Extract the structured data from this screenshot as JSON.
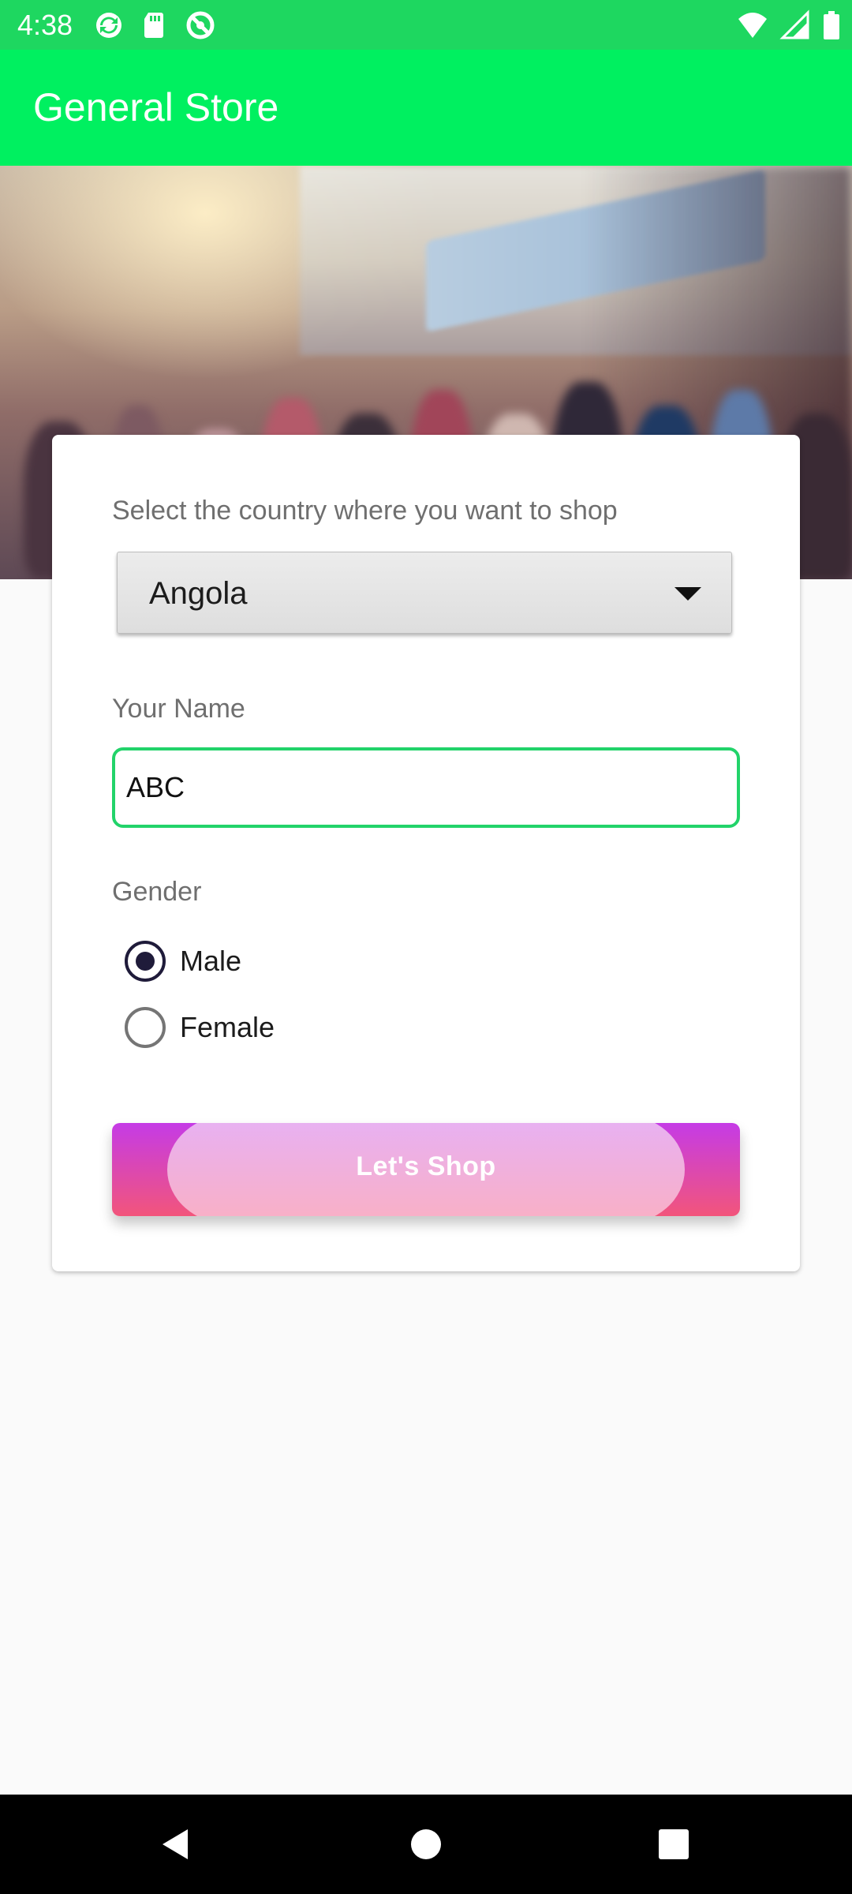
{
  "status_bar": {
    "time": "4:38",
    "left_icons": [
      "sync-icon",
      "sd-card-icon",
      "no-disturb-icon"
    ],
    "right_icons": [
      "wifi-icon",
      "cell-signal-icon",
      "battery-icon"
    ]
  },
  "app_bar": {
    "title": "General Store",
    "color": "#00f060"
  },
  "form": {
    "country_label": "Select the country where you want to shop",
    "country_value": "Angola",
    "name_label": "Your Name",
    "name_value": "ABC",
    "gender_label": "Gender",
    "gender_options": [
      {
        "label": "Male",
        "checked": true
      },
      {
        "label": "Female",
        "checked": false
      }
    ],
    "submit_label": "Let's  Shop"
  },
  "nav_bar": {
    "buttons": [
      "back-icon",
      "home-icon",
      "recents-icon"
    ]
  },
  "colors": {
    "status_bar": "#1ed760",
    "input_focus": "#22d36a",
    "radio_checked": "#1f1b3a",
    "button_gradient_top": "#c53be6",
    "button_gradient_bottom": "#f2557b"
  }
}
